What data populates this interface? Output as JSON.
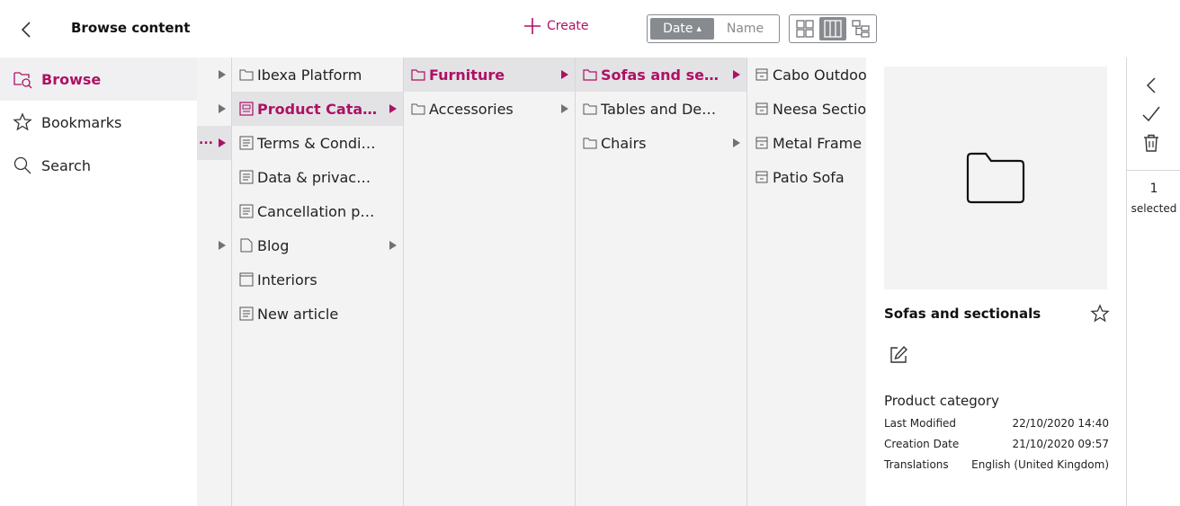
{
  "header": {
    "title": "Browse content",
    "create_label": "Create",
    "sort": {
      "date_label": "Date",
      "name_label": "Name"
    }
  },
  "sidebar": {
    "items": [
      {
        "label": "Browse",
        "icon": "browse-icon",
        "active": true
      },
      {
        "label": "Bookmarks",
        "icon": "star-icon",
        "active": false
      },
      {
        "label": "Search",
        "icon": "search-icon",
        "active": false
      }
    ]
  },
  "columns": {
    "collapsed_dots": "...",
    "col1": [
      {
        "label": "Ibexa Platform",
        "icon": "folder-icon"
      },
      {
        "label": "Product Catalog",
        "icon": "catalog-icon"
      },
      {
        "label": "Terms & Conditions",
        "icon": "article-icon"
      },
      {
        "label": "Data & privacy regulations",
        "icon": "article-icon"
      },
      {
        "label": "Cancellation policy",
        "icon": "article-icon"
      },
      {
        "label": "Blog",
        "icon": "file-icon"
      },
      {
        "label": "Interiors",
        "icon": "landing-page-icon"
      },
      {
        "label": "New article",
        "icon": "article-icon"
      }
    ],
    "col2": [
      {
        "label": "Furniture",
        "icon": "folder-icon"
      },
      {
        "label": "Accessories",
        "icon": "folder-icon"
      }
    ],
    "col3": [
      {
        "label": "Sofas and sectionals",
        "icon": "folder-icon"
      },
      {
        "label": "Tables and Desks",
        "icon": "folder-icon"
      },
      {
        "label": "Chairs",
        "icon": "folder-icon"
      }
    ],
    "col4": [
      {
        "label": "Cabo Outdoor",
        "icon": "product-icon"
      },
      {
        "label": "Neesa Sectional",
        "icon": "product-icon"
      },
      {
        "label": "Metal Frame Sofa",
        "icon": "product-icon"
      },
      {
        "label": "Patio Sofa",
        "icon": "product-icon"
      }
    ]
  },
  "preview": {
    "name": "Sofas and sectionals",
    "content_type": "Product category",
    "meta": [
      {
        "label": "Last Modified",
        "value": "22/10/2020 14:40"
      },
      {
        "label": "Creation Date",
        "value": "21/10/2020 09:57"
      },
      {
        "label": "Translations",
        "value": "English (United Kingdom)"
      }
    ]
  },
  "selection": {
    "count": "1",
    "label": "selected"
  },
  "colors": {
    "accent": "#ae1164",
    "grey": "#878b90",
    "panel": "#f3f3f4"
  }
}
